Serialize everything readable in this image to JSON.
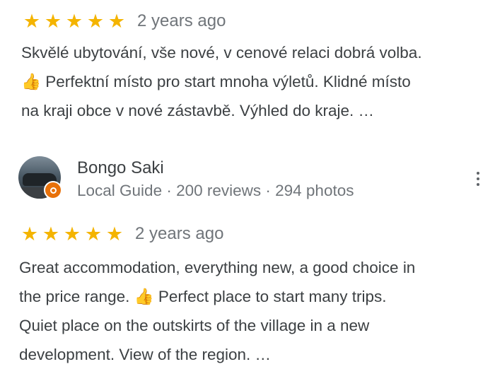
{
  "reviews": [
    {
      "stars": [
        "★",
        "★",
        "★",
        "★",
        "★"
      ],
      "rating": 5,
      "time": "2 years ago",
      "text": "Skvělé ubytování, vše nové, v cenové relaci dobrá volba.\n👍 Perfektní místo pro start mnoha výletů. Klidné místo\nna kraji obce v nové zástavbě. Výhled do kraje. …"
    },
    {
      "author": {
        "name": "Bongo Saki",
        "meta": "Local Guide · 200 reviews · 294 photos"
      },
      "stars": [
        "★",
        "★",
        "★",
        "★",
        "★"
      ],
      "rating": 5,
      "time": "2 years ago",
      "text": "Great accommodation, everything new, a good choice in\nthe price range. 👍 Perfect place to start many trips.\nQuiet place on the outskirts of the village in a new\ndevelopment. View of the region. …"
    }
  ],
  "colors": {
    "star": "#f4b400",
    "text": "#3c4043",
    "muted": "#70757a",
    "badge": "#e8710a"
  },
  "icons": {
    "star": "star-icon",
    "more": "more-vert-icon",
    "badge": "local-guide-badge-icon"
  }
}
